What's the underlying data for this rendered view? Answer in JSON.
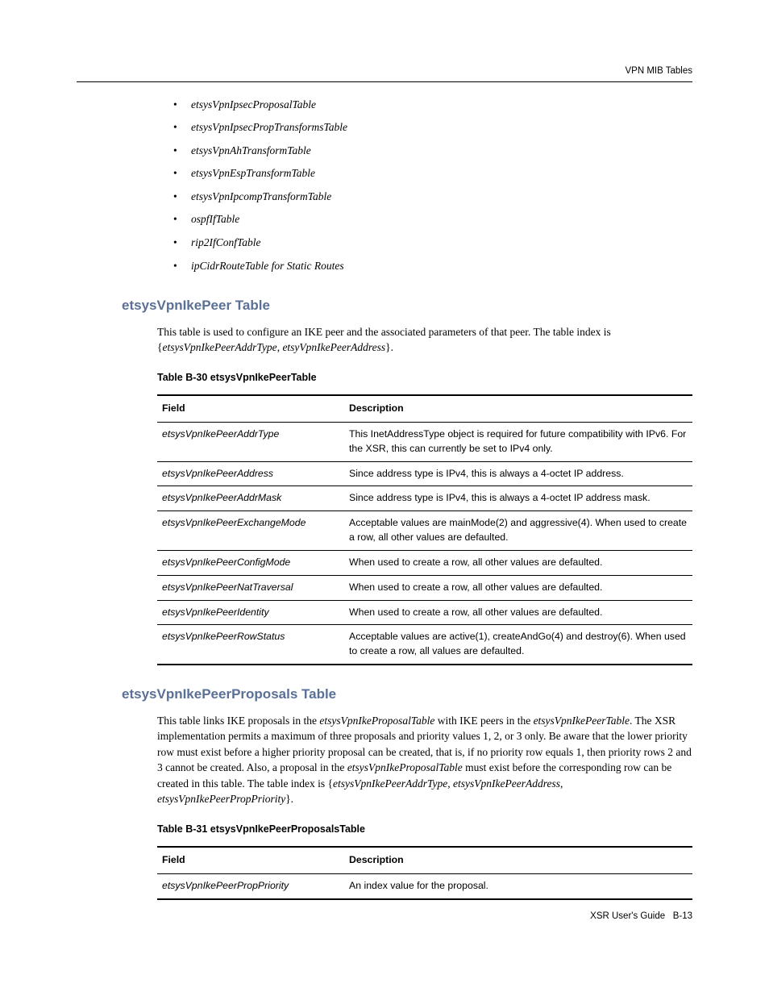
{
  "header": {
    "right": "VPN MIB Tables"
  },
  "bullets": [
    "etsysVpnIpsecProposalTable",
    "etsysVpnIpsecPropTransformsTable",
    "etsysVpnAhTransformTable",
    "etsysVpnEspTransformTable",
    "etsysVpnIpcompTransformTable",
    "ospfIfTable",
    "rip2IfConfTable",
    "ipCidrRouteTable for Static Routes"
  ],
  "section1": {
    "title": "etsysVpnIkePeer Table",
    "para_pre": "This table is used to configure an IKE peer and the associated parameters of that peer. The table index is {",
    "para_i1": "etsysVpnIkePeerAddrType",
    "para_sep": ", ",
    "para_i2": "etsyVpnIkePeerAddress",
    "para_post": "}.",
    "table_caption": "Table B-30    etsysVpnIkePeerTable",
    "th_field": "Field",
    "th_desc": "Description",
    "rows": [
      {
        "field": "etsysVpnIkePeerAddrType",
        "desc": "This InetAddressType object is required for future compatibility with IPv6. For the XSR, this can currently be set to IPv4 only."
      },
      {
        "field": "etsysVpnIkePeerAddress",
        "desc": "Since address type is IPv4, this is always a 4-octet IP address."
      },
      {
        "field": "etsysVpnIkePeerAddrMask",
        "desc": "Since address type is IPv4, this is always a 4-octet IP address mask."
      },
      {
        "field": "etsysVpnIkePeerExchangeMode",
        "desc": "Acceptable values are mainMode(2) and aggressive(4). When used to create a row, all other values are defaulted."
      },
      {
        "field": "etsysVpnIkePeerConfigMode",
        "desc": "When used to create a row, all other values are defaulted."
      },
      {
        "field": "etsysVpnIkePeerNatTraversal",
        "desc": "When used to create a row, all other values are defaulted."
      },
      {
        "field": "etsysVpnIkePeerIdentity",
        "desc": "When used to create a row, all other values are defaulted."
      },
      {
        "field": "etsysVpnIkePeerRowStatus",
        "desc": "Acceptable values are active(1), createAndGo(4) and destroy(6). When used to create a row, all values are defaulted."
      }
    ]
  },
  "section2": {
    "title": "etsysVpnIkePeerProposals Table",
    "p1a": "This table links IKE proposals in the ",
    "p1i1": "etsysVpnIkeProposalTable",
    "p1b": " with IKE peers in the ",
    "p1i2": "etsysVpnIkePeerTable",
    "p1c": ". The XSR implementation permits a maximum of three proposals and priority values 1, 2, or 3 only. Be aware that the lower priority row must exist before a higher priority proposal can be created, that is, if no priority row equals 1, then priority rows 2 and 3 cannot be created. Also, a proposal in the ",
    "p1i3": "etsysVpnIkeProposalTable",
    "p1d": " must exist before the corresponding row can be created in this table. The table index is {",
    "p1i4": "etsysVpnIkePeerAddrType",
    "p1e": ", ",
    "p1i5": "etsysVpnIkePeerAddress",
    "p1f": ", ",
    "p1i6": "etsysVpnIkePeerPropPriority",
    "p1g": "}.",
    "table_caption": "Table B-31    etsysVpnIkePeerProposalsTable",
    "th_field": "Field",
    "th_desc": "Description",
    "rows": [
      {
        "field": "etsysVpnIkePeerPropPriority",
        "desc": "An index value for the proposal."
      }
    ]
  },
  "footer": {
    "left": "XSR User's Guide",
    "right": "B-13"
  }
}
